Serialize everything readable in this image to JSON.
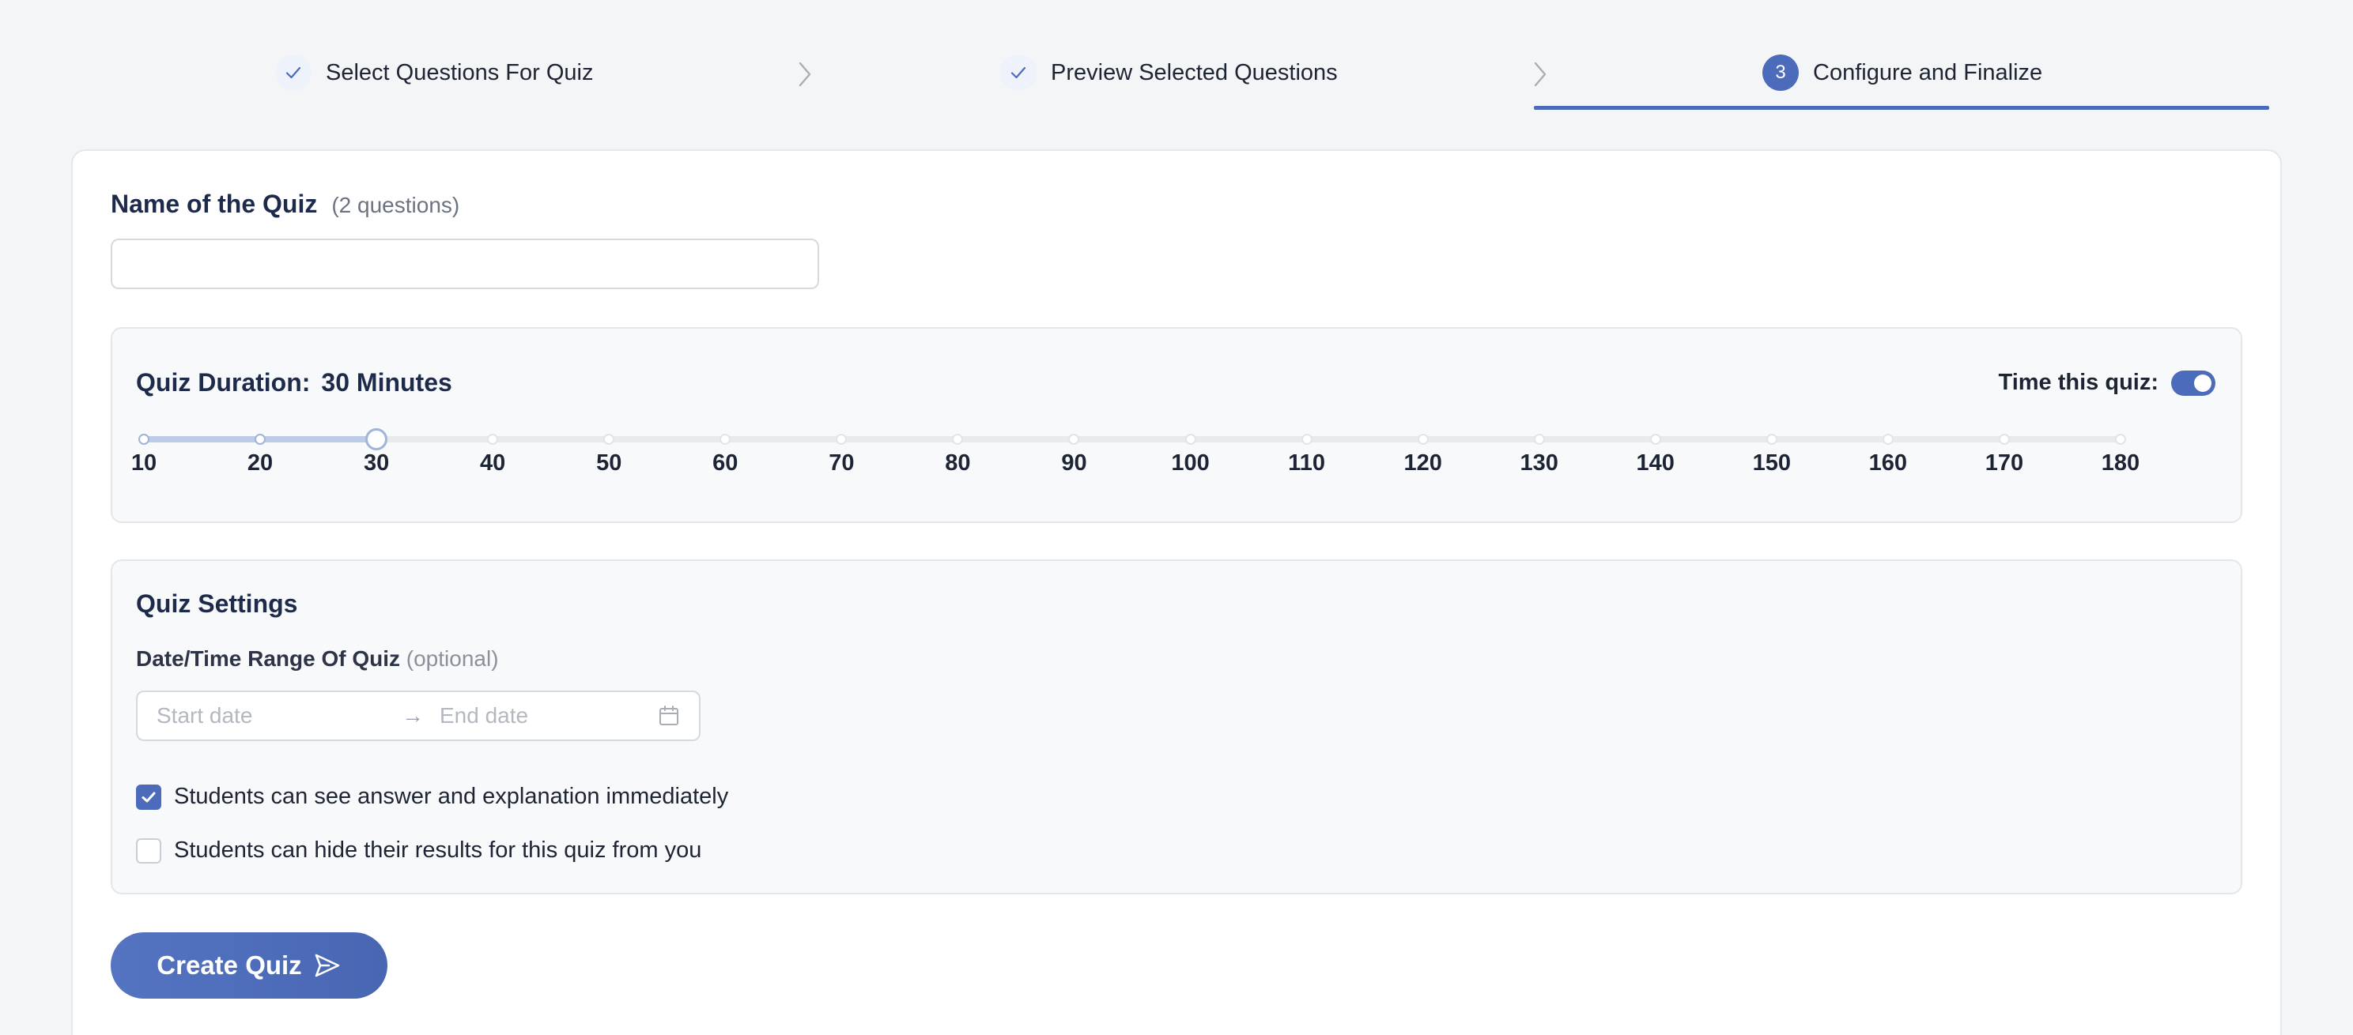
{
  "steps": [
    {
      "label": "Select Questions For Quiz",
      "status": "done",
      "icon": "check-icon"
    },
    {
      "label": "Preview Selected Questions",
      "status": "done",
      "icon": "check-icon"
    },
    {
      "label": "Configure and Finalize",
      "status": "active",
      "number": "3"
    }
  ],
  "quiz_name": {
    "label": "Name of the Quiz",
    "count": "(2 questions)",
    "value": ""
  },
  "duration": {
    "title": "Quiz Duration:",
    "value_text": "30 Minutes",
    "timer_label": "Time this quiz:",
    "timer_on": true,
    "selected": 30,
    "ticks": [
      "10",
      "20",
      "30",
      "40",
      "50",
      "60",
      "70",
      "80",
      "90",
      "100",
      "110",
      "120",
      "130",
      "140",
      "150",
      "160",
      "170",
      "180"
    ]
  },
  "settings": {
    "title": "Quiz Settings",
    "range_label": "Date/Time Range Of Quiz",
    "range_optional": "(optional)",
    "start_placeholder": "Start date",
    "end_placeholder": "End date",
    "arrow": "→",
    "options": [
      {
        "label": "Students can see answer and explanation immediately",
        "checked": true
      },
      {
        "label": "Students can hide their results for this quiz from you",
        "checked": false
      }
    ]
  },
  "create_button": {
    "label": "Create Quiz",
    "icon": "send-icon"
  },
  "colors": {
    "accent": "#4d6bbb",
    "background": "#f4f5f6"
  }
}
